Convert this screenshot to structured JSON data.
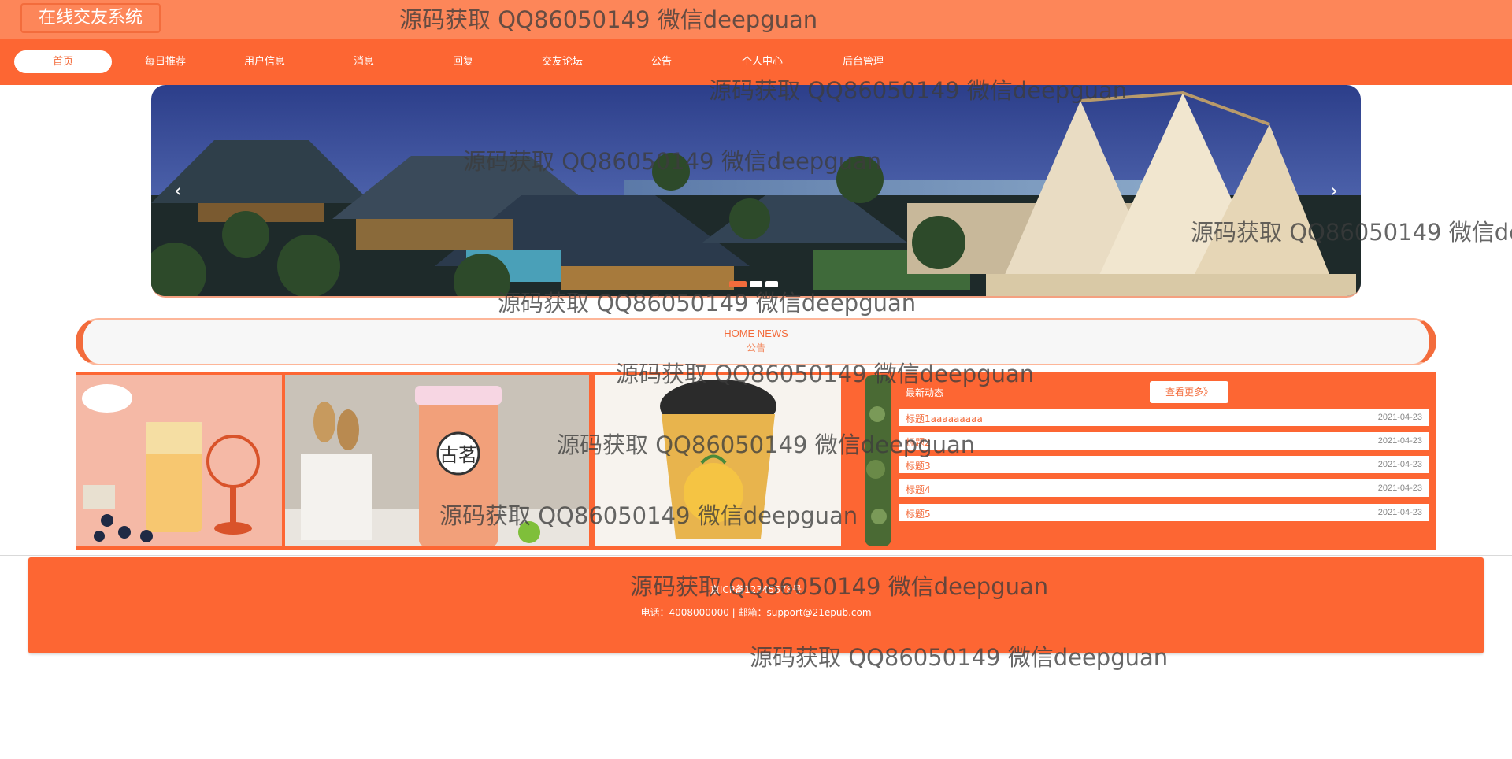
{
  "app": {
    "logo": "在线交友系统"
  },
  "nav": {
    "items": [
      {
        "label": "首页",
        "active": true
      },
      {
        "label": "每日推荐",
        "active": false
      },
      {
        "label": "用户信息",
        "active": false
      },
      {
        "label": "消息",
        "active": false
      },
      {
        "label": "回复",
        "active": false
      },
      {
        "label": "交友论坛",
        "active": false
      },
      {
        "label": "公告",
        "active": false
      },
      {
        "label": "个人中心",
        "active": false
      },
      {
        "label": "后台管理",
        "active": false
      }
    ]
  },
  "banner": {
    "prev_glyph": "‹",
    "next_glyph": "›",
    "slides": 3,
    "active_slide": 1
  },
  "news_header": {
    "en": "HOME NEWS",
    "cn": "公告"
  },
  "news_panel": {
    "title": "最新动态",
    "more": "查看更多》",
    "items": [
      {
        "title": "标题1aaaaaaaaa",
        "date": "2021-04-23"
      },
      {
        "title": "标题2",
        "date": "2021-04-23"
      },
      {
        "title": "标题3",
        "date": "2021-04-23"
      },
      {
        "title": "标题4",
        "date": "2021-04-23"
      },
      {
        "title": "标题5",
        "date": "2021-04-23"
      }
    ]
  },
  "products": {
    "cup_brand": "古茗"
  },
  "footer": {
    "icp": "京ICP备12345678号",
    "contact": "电话：4008000000 | 邮箱：support@21epub.com"
  },
  "watermark": "源码获取 QQ86050149 微信deepguan",
  "colors": {
    "primary": "#fd6633",
    "header": "#fd8659",
    "accent": "#f36c3c"
  }
}
